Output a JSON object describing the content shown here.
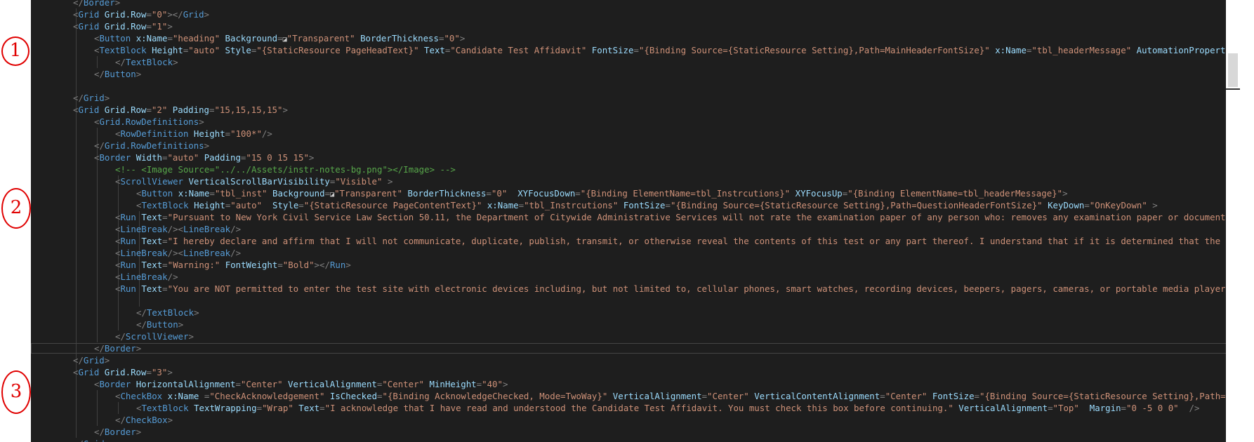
{
  "colors": {
    "tag": "#569cd6",
    "attr": "#9cdcfe",
    "value": "#ce9178",
    "punct": "#808080",
    "text": "#d4d4d4",
    "comment": "#57a64a",
    "annotation": "#e00000",
    "editor_bg": "#1e1e1e"
  },
  "annotations": [
    "1",
    "2",
    "3"
  ],
  "code_lines": [
    [
      [
        "p",
        "</"
      ],
      [
        "t",
        "Border"
      ],
      [
        "p",
        ">"
      ]
    ],
    [
      [
        "p",
        "<"
      ],
      [
        "t",
        "Grid"
      ],
      [
        "a",
        " Grid.Row"
      ],
      [
        "p",
        "="
      ],
      [
        "v",
        "\"0\""
      ],
      [
        "p",
        "></"
      ],
      [
        "t",
        "Grid"
      ],
      [
        "p",
        ">"
      ]
    ],
    [
      [
        "p",
        "<"
      ],
      [
        "t",
        "Grid"
      ],
      [
        "a",
        " Grid.Row"
      ],
      [
        "p",
        "="
      ],
      [
        "v",
        "\"1\""
      ],
      [
        "p",
        ">"
      ]
    ],
    [
      [
        "p",
        "<"
      ],
      [
        "t",
        "Button"
      ],
      [
        "a",
        " x:Name"
      ],
      [
        "p",
        "="
      ],
      [
        "v",
        "\"heading\""
      ],
      [
        "a",
        " Background"
      ],
      [
        "p",
        "="
      ],
      [
        "x",
        "◪"
      ],
      [
        "v",
        "\"Transparent\""
      ],
      [
        "a",
        " BorderThickness"
      ],
      [
        "p",
        "="
      ],
      [
        "v",
        "\"0\""
      ],
      [
        "p",
        ">"
      ]
    ],
    [
      [
        "p",
        "<"
      ],
      [
        "t",
        "TextBlock"
      ],
      [
        "a",
        " Height"
      ],
      [
        "p",
        "="
      ],
      [
        "v",
        "\"auto\""
      ],
      [
        "a",
        " Style"
      ],
      [
        "p",
        "="
      ],
      [
        "v",
        "\"{StaticResource PageHeadText}\""
      ],
      [
        "a",
        " Text"
      ],
      [
        "p",
        "="
      ],
      [
        "v",
        "\"Candidate Test Affidavit\""
      ],
      [
        "a",
        " FontSize"
      ],
      [
        "p",
        "="
      ],
      [
        "v",
        "\"{Binding Source={StaticResource Setting},Path=MainHeaderFontSize}\""
      ],
      [
        "a",
        " x:Name"
      ],
      [
        "p",
        "="
      ],
      [
        "v",
        "\"tbl_headerMessage\""
      ],
      [
        "a",
        " AutomationProperties"
      ]
    ],
    [
      [
        "p",
        "</"
      ],
      [
        "t",
        "TextBlock"
      ],
      [
        "p",
        ">"
      ]
    ],
    [
      [
        "p",
        "</"
      ],
      [
        "t",
        "Button"
      ],
      [
        "p",
        ">"
      ]
    ],
    [],
    [
      [
        "p",
        "</"
      ],
      [
        "t",
        "Grid"
      ],
      [
        "p",
        ">"
      ]
    ],
    [
      [
        "p",
        "<"
      ],
      [
        "t",
        "Grid"
      ],
      [
        "a",
        " Grid.Row"
      ],
      [
        "p",
        "="
      ],
      [
        "v",
        "\"2\""
      ],
      [
        "a",
        " Padding"
      ],
      [
        "p",
        "="
      ],
      [
        "v",
        "\"15,15,15,15\""
      ],
      [
        "p",
        ">"
      ]
    ],
    [
      [
        "p",
        "<"
      ],
      [
        "t",
        "Grid.RowDefinitions"
      ],
      [
        "p",
        ">"
      ]
    ],
    [
      [
        "p",
        "<"
      ],
      [
        "t",
        "RowDefinition"
      ],
      [
        "a",
        " Height"
      ],
      [
        "p",
        "="
      ],
      [
        "v",
        "\"100*\""
      ],
      [
        "p",
        "/>"
      ]
    ],
    [
      [
        "p",
        "</"
      ],
      [
        "t",
        "Grid.RowDefinitions"
      ],
      [
        "p",
        ">"
      ]
    ],
    [
      [
        "p",
        "<"
      ],
      [
        "t",
        "Border"
      ],
      [
        "a",
        " Width"
      ],
      [
        "p",
        "="
      ],
      [
        "v",
        "\"auto\""
      ],
      [
        "a",
        " Padding"
      ],
      [
        "p",
        "="
      ],
      [
        "v",
        "\"15 0 15 15\""
      ],
      [
        "p",
        ">"
      ]
    ],
    [
      [
        "c",
        "<!-- <Image Source=\"../../Assets/instr-notes-bg.png\"></Image> -->"
      ]
    ],
    [
      [
        "p",
        "<"
      ],
      [
        "t",
        "ScrollViewer"
      ],
      [
        "a",
        " VerticalScrollBarVisibility"
      ],
      [
        "p",
        "="
      ],
      [
        "v",
        "\"Visible\""
      ],
      [
        "p",
        " >"
      ]
    ],
    [
      [
        "p",
        "<"
      ],
      [
        "t",
        "Button"
      ],
      [
        "a",
        " x:Name"
      ],
      [
        "p",
        "="
      ],
      [
        "v",
        "\"tbl_inst\""
      ],
      [
        "a",
        " Background"
      ],
      [
        "p",
        "="
      ],
      [
        "x",
        "◪"
      ],
      [
        "v",
        "\"Transparent\""
      ],
      [
        "a",
        " BorderThickness"
      ],
      [
        "p",
        "="
      ],
      [
        "v",
        "\"0\""
      ],
      [
        "a",
        "  XYFocusDown"
      ],
      [
        "p",
        "="
      ],
      [
        "v",
        "\"{Binding ElementName=tbl_Instrcutions}\""
      ],
      [
        "a",
        " XYFocusUp"
      ],
      [
        "p",
        "="
      ],
      [
        "v",
        "\"{Binding ElementName=tbl_headerMessage}\""
      ],
      [
        "p",
        ">"
      ]
    ],
    [
      [
        "p",
        "<"
      ],
      [
        "t",
        "TextBlock"
      ],
      [
        "a",
        " Height"
      ],
      [
        "p",
        "="
      ],
      [
        "v",
        "\"auto\""
      ],
      [
        "a",
        "  Style"
      ],
      [
        "p",
        "="
      ],
      [
        "v",
        "\"{StaticResource PageContentText}\""
      ],
      [
        "a",
        " x:Name"
      ],
      [
        "p",
        "="
      ],
      [
        "v",
        "\"tbl_Instrcutions\""
      ],
      [
        "a",
        " FontSize"
      ],
      [
        "p",
        "="
      ],
      [
        "v",
        "\"{Binding Source={StaticResource Setting},Path=QuestionHeaderFontSize}\""
      ],
      [
        "a",
        " KeyDown"
      ],
      [
        "p",
        "="
      ],
      [
        "v",
        "\"OnKeyDown\""
      ],
      [
        "p",
        " >"
      ]
    ],
    [
      [
        "p",
        "<"
      ],
      [
        "t",
        "Run"
      ],
      [
        "a",
        " Text"
      ],
      [
        "p",
        "="
      ],
      [
        "v",
        "\"Pursuant to New York Civil Service Law Section 50.11, the Department of Citywide Administrative Services will not rate the examination paper of any person who: removes any examination paper or document fr"
      ]
    ],
    [
      [
        "p",
        "<"
      ],
      [
        "t",
        "LineBreak"
      ],
      [
        "p",
        "/><"
      ],
      [
        "t",
        "LineBreak"
      ],
      [
        "p",
        "/>"
      ]
    ],
    [
      [
        "p",
        "<"
      ],
      [
        "t",
        "Run"
      ],
      [
        "a",
        " Text"
      ],
      [
        "p",
        "="
      ],
      [
        "v",
        "\"I hereby declare and affirm that I will not communicate, duplicate, publish, transmit, or otherwise reveal the contents of this test or any part thereof. I understand that if it is determined that the con"
      ]
    ],
    [
      [
        "p",
        "<"
      ],
      [
        "t",
        "LineBreak"
      ],
      [
        "p",
        "/><"
      ],
      [
        "t",
        "LineBreak"
      ],
      [
        "p",
        "/>"
      ]
    ],
    [
      [
        "p",
        "<"
      ],
      [
        "t",
        "Run"
      ],
      [
        "a",
        " Text"
      ],
      [
        "p",
        "="
      ],
      [
        "v",
        "\"Warning:\""
      ],
      [
        "a",
        " FontWeight"
      ],
      [
        "p",
        "="
      ],
      [
        "v",
        "\"Bold\""
      ],
      [
        "p",
        "></"
      ],
      [
        "t",
        "Run"
      ],
      [
        "p",
        ">"
      ]
    ],
    [
      [
        "p",
        "<"
      ],
      [
        "t",
        "LineBreak"
      ],
      [
        "p",
        "/>"
      ]
    ],
    [
      [
        "p",
        "<"
      ],
      [
        "t",
        "Run"
      ],
      [
        "a",
        " Text"
      ],
      [
        "p",
        "="
      ],
      [
        "v",
        "\"You are NOT permitted to enter the test site with electronic devices including, but not limited to, cellular phones, smart watches, recording devices, beepers, pagers, cameras, or portable media players. "
      ]
    ],
    [],
    [
      [
        "p",
        "</"
      ],
      [
        "t",
        "TextBlock"
      ],
      [
        "p",
        ">"
      ]
    ],
    [
      [
        "p",
        "</"
      ],
      [
        "t",
        "Button"
      ],
      [
        "p",
        ">"
      ]
    ],
    [
      [
        "p",
        "</"
      ],
      [
        "t",
        "ScrollViewer"
      ],
      [
        "p",
        ">"
      ]
    ],
    [
      [
        "p",
        "</"
      ],
      [
        "t",
        "Border"
      ],
      [
        "p",
        ">"
      ]
    ],
    [
      [
        "p",
        "</"
      ],
      [
        "t",
        "Grid"
      ],
      [
        "p",
        ">"
      ]
    ],
    [
      [
        "p",
        "<"
      ],
      [
        "t",
        "Grid"
      ],
      [
        "a",
        " Grid.Row"
      ],
      [
        "p",
        "="
      ],
      [
        "v",
        "\"3\""
      ],
      [
        "p",
        ">"
      ]
    ],
    [
      [
        "p",
        "<"
      ],
      [
        "t",
        "Border"
      ],
      [
        "a",
        " HorizontalAlignment"
      ],
      [
        "p",
        "="
      ],
      [
        "v",
        "\"Center\""
      ],
      [
        "a",
        " VerticalAlignment"
      ],
      [
        "p",
        "="
      ],
      [
        "v",
        "\"Center\""
      ],
      [
        "a",
        " MinHeight"
      ],
      [
        "p",
        "="
      ],
      [
        "v",
        "\"40\""
      ],
      [
        "p",
        ">"
      ]
    ],
    [
      [
        "p",
        "<"
      ],
      [
        "t",
        "CheckBox"
      ],
      [
        "a",
        " x:Name "
      ],
      [
        "p",
        "="
      ],
      [
        "v",
        "\"CheckAcknowledgement\""
      ],
      [
        "a",
        " IsChecked"
      ],
      [
        "p",
        "="
      ],
      [
        "v",
        "\"{Binding AcknowledgeChecked, Mode=TwoWay}\""
      ],
      [
        "a",
        " VerticalAlignment"
      ],
      [
        "p",
        "="
      ],
      [
        "v",
        "\"Center\""
      ],
      [
        "a",
        " VerticalContentAlignment"
      ],
      [
        "p",
        "="
      ],
      [
        "v",
        "\"Center\""
      ],
      [
        "a",
        " FontSize"
      ],
      [
        "p",
        "="
      ],
      [
        "v",
        "\"{Binding Source={StaticResource Setting},Path="
      ]
    ],
    [
      [
        "p",
        "<"
      ],
      [
        "t",
        "TextBlock"
      ],
      [
        "a",
        " TextWrapping"
      ],
      [
        "p",
        "="
      ],
      [
        "v",
        "\"Wrap\""
      ],
      [
        "a",
        " Text"
      ],
      [
        "p",
        "="
      ],
      [
        "v",
        "\"I acknowledge that I have read and understood the Candidate Test Affidavit. You must check this box before continuing.\""
      ],
      [
        "a",
        " VerticalAlignment"
      ],
      [
        "p",
        "="
      ],
      [
        "v",
        "\"Top\""
      ],
      [
        "a",
        "  Margin"
      ],
      [
        "p",
        "="
      ],
      [
        "v",
        "\"0 -5 0 0\""
      ],
      [
        "p",
        "  />"
      ]
    ],
    [
      [
        "p",
        "</"
      ],
      [
        "t",
        "CheckBox"
      ],
      [
        "p",
        ">"
      ]
    ],
    [
      [
        "p",
        "</"
      ],
      [
        "t",
        "Border"
      ],
      [
        "p",
        ">"
      ]
    ],
    [
      [
        "p",
        "</"
      ],
      [
        "t",
        "Grid"
      ],
      [
        "p",
        ">"
      ]
    ]
  ]
}
